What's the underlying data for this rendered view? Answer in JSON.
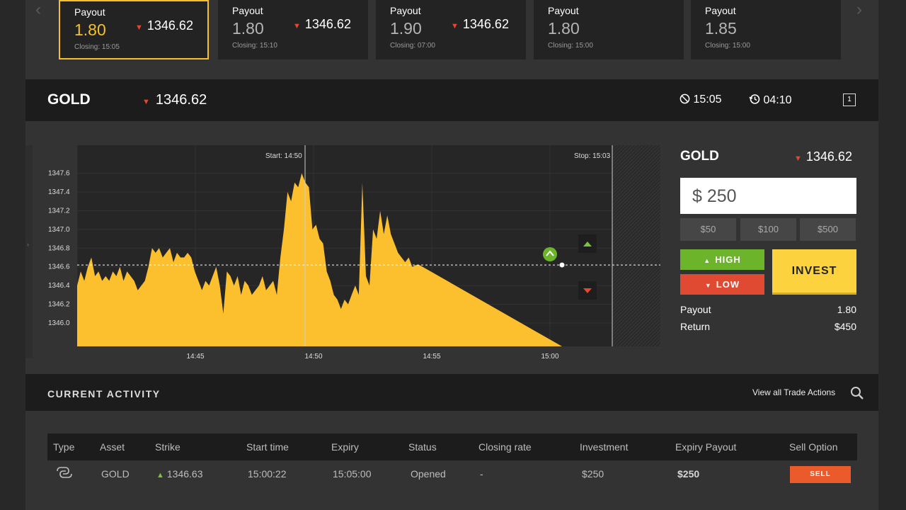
{
  "payout_cards": [
    {
      "payout_label": "Payout",
      "payout": "1.80",
      "price": "1346.62",
      "closing": "Closing: 15:05",
      "active": true
    },
    {
      "payout_label": "Payout",
      "payout": "1.80",
      "price": "1346.62",
      "closing": "Closing: 15:10",
      "active": false
    },
    {
      "payout_label": "Payout",
      "payout": "1.90",
      "price": "1346.62",
      "closing": "Closing: 07:00",
      "active": false
    },
    {
      "payout_label": "Payout",
      "payout": "1.80",
      "price": null,
      "closing": "Closing: 15:00",
      "active": false
    },
    {
      "payout_label": "Payout",
      "payout": "1.85",
      "price": null,
      "closing": "Closing: 15:00",
      "active": false
    }
  ],
  "asset_header": {
    "name": "GOLD",
    "price": "1346.62",
    "expiry_time": "15:05",
    "countdown": "04:10",
    "icon_label": "1"
  },
  "chart_data": {
    "type": "area",
    "y_ticks": [
      "1347.6",
      "1347.4",
      "1347.2",
      "1347.0",
      "1346.8",
      "1346.6",
      "1346.4",
      "1346.2",
      "1346.0"
    ],
    "x_ticks": [
      "14:45",
      "14:50",
      "14:55",
      "15:00"
    ],
    "start_label": "Start: 14:50",
    "stop_label": "Stop: 15:03",
    "current_level": 1346.62,
    "ylim": [
      1345.75,
      1347.9
    ],
    "x": [
      0,
      3,
      6,
      9,
      12,
      15,
      18,
      21,
      24,
      27,
      30,
      33,
      36,
      39,
      42,
      45,
      48,
      51,
      54,
      57,
      60,
      63,
      66,
      69,
      72,
      75,
      78,
      81,
      84,
      87,
      90,
      93,
      96,
      99,
      102,
      105,
      108,
      111,
      114,
      117,
      120,
      123,
      126,
      129,
      132,
      135,
      138,
      141,
      144,
      147,
      150,
      153,
      156,
      159,
      162,
      165,
      168,
      171,
      174,
      177,
      180,
      183,
      186,
      189,
      192,
      195,
      198,
      201,
      204,
      207,
      210,
      213,
      216,
      219,
      222,
      225,
      228,
      231,
      234,
      237,
      240,
      243,
      246,
      249,
      252,
      255,
      258,
      261,
      264,
      267,
      270,
      273,
      276,
      279,
      282,
      285,
      288,
      291,
      294,
      297,
      300,
      303,
      306,
      309,
      312,
      315,
      318,
      321,
      324,
      327,
      330,
      333,
      336,
      339,
      342,
      345,
      348,
      351,
      354,
      357,
      360,
      363,
      366,
      369,
      372,
      375,
      378,
      381,
      384,
      387,
      390,
      393,
      396,
      399,
      402,
      405,
      408
    ],
    "values": [
      1346.4,
      1346.55,
      1346.45,
      1346.6,
      1346.7,
      1346.5,
      1346.55,
      1346.45,
      1346.5,
      1346.45,
      1346.55,
      1346.5,
      1346.6,
      1346.45,
      1346.55,
      1346.5,
      1346.45,
      1346.35,
      1346.4,
      1346.45,
      1346.6,
      1346.8,
      1346.75,
      1346.8,
      1346.7,
      1346.75,
      1346.8,
      1346.65,
      1346.75,
      1346.7,
      1346.7,
      1346.75,
      1346.7,
      1346.55,
      1346.45,
      1346.35,
      1346.45,
      1346.4,
      1346.5,
      1346.6,
      1346.4,
      1346.1,
      1346.55,
      1346.5,
      1346.4,
      1346.5,
      1346.3,
      1346.45,
      1346.4,
      1346.3,
      1346.35,
      1346.4,
      1346.5,
      1346.35,
      1346.4,
      1346.45,
      1346.3,
      1346.7,
      1347.0,
      1347.4,
      1347.3,
      1347.5,
      1347.45,
      1347.6,
      1347.5,
      1347.45,
      1347.0,
      1347.05,
      1346.9,
      1346.85,
      1346.55,
      1346.45,
      1346.3,
      1346.25,
      1346.15,
      1346.25,
      1346.2,
      1346.3,
      1346.4,
      1346.3,
      1347.5,
      1346.5,
      1346.4,
      1347.0,
      1346.9,
      1347.2,
      1346.95,
      1347.15,
      1346.95,
      1346.85,
      1346.75,
      1346.7,
      1346.65,
      1346.7,
      1346.6,
      1346.62,
      1346.62
    ],
    "markers": {
      "high_arrow": "up",
      "low_arrow": "down"
    }
  },
  "trade_panel": {
    "asset": "GOLD",
    "price": "1346.62",
    "amount": "$ 250",
    "quick_amounts": [
      "$50",
      "$100",
      "$500"
    ],
    "high_label": "HIGH",
    "low_label": "LOW",
    "invest_label": "INVEST",
    "payout_label": "Payout",
    "payout_value": "1.80",
    "return_label": "Return",
    "return_value": "$450"
  },
  "activity": {
    "title": "CURRENT ACTIVITY",
    "view_all": "View all Trade Actions",
    "columns": [
      "Type",
      "Asset",
      "Strike",
      "Start time",
      "Expiry",
      "Status",
      "Closing rate",
      "Investment",
      "Expiry Payout",
      "Sell Option"
    ],
    "rows": [
      {
        "asset": "GOLD",
        "strike": "1346.63",
        "start": "15:00:22",
        "expiry": "15:05:00",
        "status": "Opened",
        "closing_rate": "-",
        "investment": "$250",
        "payout": "$250",
        "sell": "SELL"
      }
    ]
  },
  "colors": {
    "accent_yellow": "#fcd33f",
    "high_green": "#6cb42a",
    "low_red": "#e04a32",
    "sell_orange": "#ea5a2a"
  }
}
